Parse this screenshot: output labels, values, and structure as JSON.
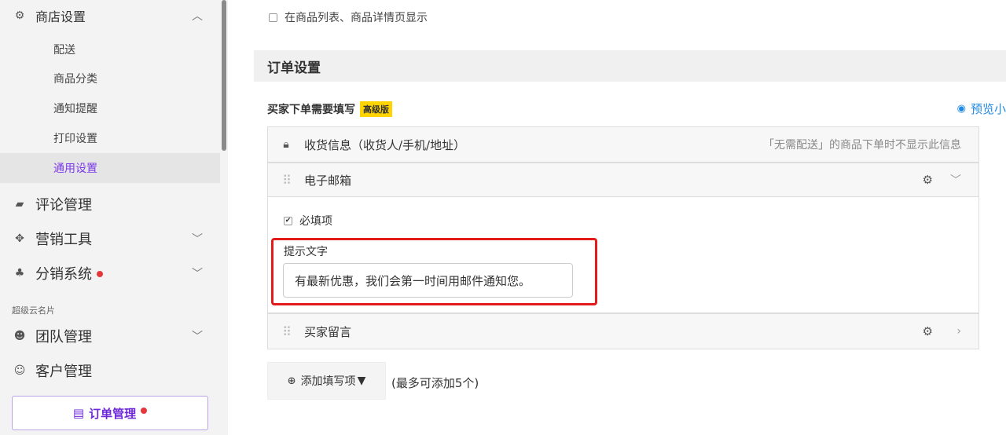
{
  "sidebar": {
    "shop_settings": {
      "label": "商店设置",
      "expanded": true
    },
    "sub_items": [
      {
        "label": "配送",
        "active": false
      },
      {
        "label": "商品分类",
        "active": false
      },
      {
        "label": "通知提醒",
        "active": false
      },
      {
        "label": "打印设置",
        "active": false
      },
      {
        "label": "通用设置",
        "active": true
      }
    ],
    "review": {
      "label": "评论管理"
    },
    "marketing": {
      "label": "营销工具"
    },
    "distribution": {
      "label": "分销系统",
      "has_dot": true
    },
    "section_label": "超级云名片",
    "team": {
      "label": "团队管理"
    },
    "customer": {
      "label": "客户管理"
    },
    "order": {
      "label": "订单管理",
      "has_dot": true
    }
  },
  "main": {
    "top_checkbox": {
      "label": "在商品列表、商品详情页显示",
      "checked": false
    },
    "order_section_title": "订单设置",
    "buyer_fields_title": "买家下单需要填写",
    "badge": "高级版",
    "preview_label": "预览小",
    "fields": [
      {
        "label": "收货信息（收货人/手机/地址）",
        "hint": "「无需配送」的商品下单时不显示此信息",
        "locked": true
      },
      {
        "label": "电子邮箱",
        "expanded": true
      },
      {
        "label": "买家留言",
        "expanded": false
      }
    ],
    "email_panel": {
      "required_label": "必填项",
      "required_checked": true,
      "tip_label": "提示文字",
      "tip_value": "有最新优惠，我们会第一时间用邮件通知您。"
    },
    "add_button": "添加填写项",
    "add_note": "(最多可添加5个)"
  },
  "colors": {
    "accent": "#7c3aed",
    "link": "#1e88e5",
    "badge": "#ffd400",
    "highlight": "#e31b1b",
    "dot": "#e5383b"
  }
}
